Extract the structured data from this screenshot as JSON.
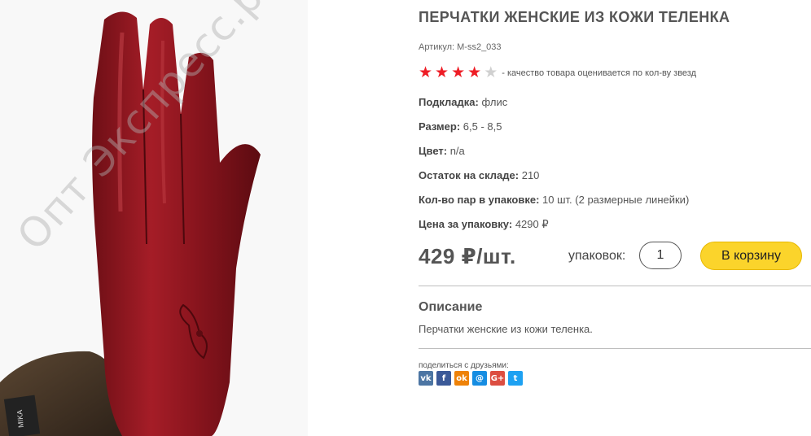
{
  "product": {
    "title": "ПЕРЧАТКИ ЖЕНСКИЕ ИЗ КОЖИ ТЕЛЕНКА",
    "sku": "Артикул: M-ss2_033",
    "image_watermark": "Опт Экспресс.рф",
    "image_tag_text": "MIKA"
  },
  "rating": {
    "value": 4,
    "max": 5,
    "caption": "- качество товара оценивается по кол-ву звезд",
    "colors": {
      "active": "#ee1c25",
      "inactive": "#d0d0d0"
    }
  },
  "attributes": [
    {
      "label": "Подкладка:",
      "value": "флис"
    },
    {
      "label": "Размер:",
      "value": "6,5 - 8,5"
    },
    {
      "label": "Цвет:",
      "value": "n/a"
    },
    {
      "label": "Остаток на складе:",
      "value": "210"
    },
    {
      "label": "Кол-во пар в упаковке:",
      "value": "10 шт. (2 размерные линейки)"
    },
    {
      "label": "Цена за упаковку:",
      "value": "4290 ₽"
    }
  ],
  "purchase": {
    "price": "429 ₽/шт.",
    "qty_label": "упаковок:",
    "qty_value": "1",
    "cart_button": "В корзину",
    "cart_color": "#fbd42b"
  },
  "description": {
    "title": "Описание",
    "text": "Перчатки женские из кожи теленка."
  },
  "share": {
    "label": "поделиться с друзьями:",
    "networks": [
      {
        "name": "vk-icon",
        "glyph": "vk",
        "color": "#4c75a3"
      },
      {
        "name": "facebook-icon",
        "glyph": "f",
        "color": "#3b5998"
      },
      {
        "name": "odnoklassniki-icon",
        "glyph": "ok",
        "color": "#ee8208"
      },
      {
        "name": "moimir-icon",
        "glyph": "@",
        "color": "#168de2"
      },
      {
        "name": "googleplus-icon",
        "glyph": "G+",
        "color": "#dc4e41"
      },
      {
        "name": "twitter-icon",
        "glyph": "t",
        "color": "#1da1f2"
      }
    ]
  }
}
